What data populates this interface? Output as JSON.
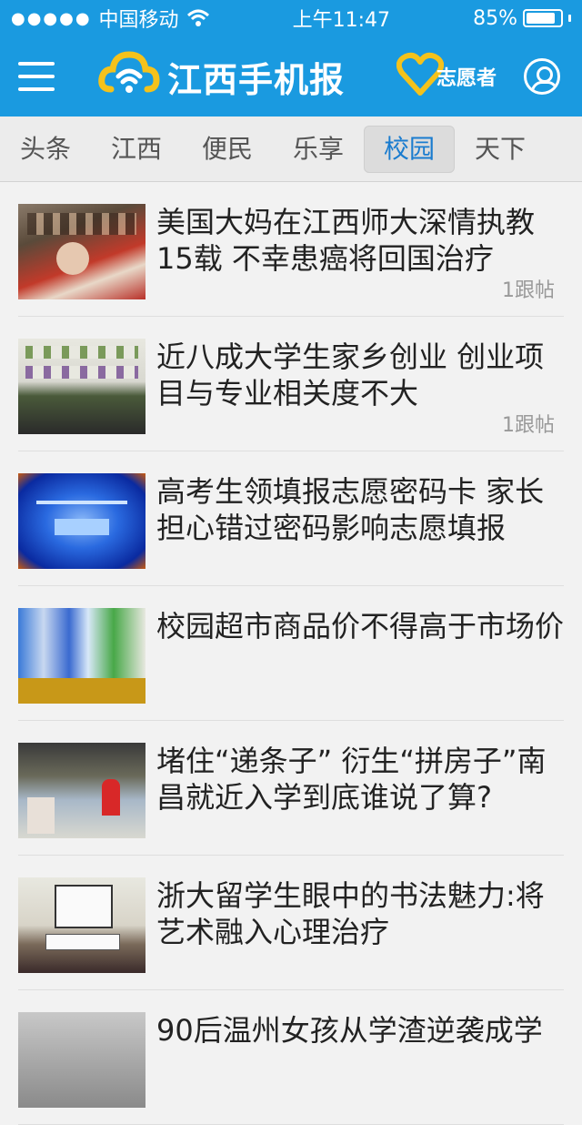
{
  "status": {
    "carrier": "中国移动",
    "time": "上午11:47",
    "battery": "85%",
    "battery_level": 0.85
  },
  "header": {
    "app_name": "江西手机报",
    "volunteer_label": "志愿者"
  },
  "tabs": [
    {
      "label": "头条"
    },
    {
      "label": "江西"
    },
    {
      "label": "便民"
    },
    {
      "label": "乐享"
    },
    {
      "label": "校园"
    },
    {
      "label": "天下"
    }
  ],
  "articles": [
    {
      "title": "美国大妈在江西师大深情执教15载 不幸患癌将回国治疗",
      "replies": "1跟帖"
    },
    {
      "title": "近八成大学生家乡创业 创业项目与专业相关度不大",
      "replies": "1跟帖"
    },
    {
      "title": "高考生领填报志愿密码卡 家长担心错过密码影响志愿填报",
      "replies": ""
    },
    {
      "title": "校园超市商品价不得高于市场价",
      "replies": ""
    },
    {
      "title": "堵住“递条子” 衍生“拼房子”南昌就近入学到底谁说了算?",
      "replies": ""
    },
    {
      "title": "浙大留学生眼中的书法魅力:将艺术融入心理治疗",
      "replies": ""
    },
    {
      "title": "90后温州女孩从学渣逆袭成学",
      "replies": ""
    }
  ],
  "colors": {
    "header_bg": "#1a9ae0",
    "active_tab": "#1a7ccf",
    "logo_yellow": "#f4c21b"
  }
}
